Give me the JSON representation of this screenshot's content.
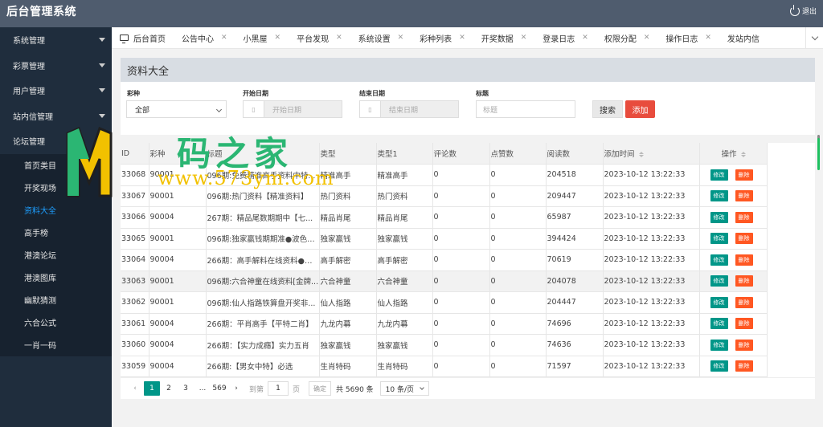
{
  "header": {
    "title": "后台管理系统",
    "logout_label": "退出"
  },
  "sidebar": {
    "groups": [
      {
        "label": "系统管理"
      },
      {
        "label": "彩票管理"
      },
      {
        "label": "用户管理"
      },
      {
        "label": "站内信管理"
      },
      {
        "label": "论坛管理"
      }
    ],
    "sub_items": [
      {
        "label": "首页类目"
      },
      {
        "label": "开奖现场"
      },
      {
        "label": "资料大全",
        "active": true
      },
      {
        "label": "高手榜"
      },
      {
        "label": "港澳论坛"
      },
      {
        "label": "港澳图库"
      },
      {
        "label": "幽默猜测"
      },
      {
        "label": "六合公式"
      },
      {
        "label": "一肖一码"
      }
    ]
  },
  "tabs": [
    {
      "label": "后台首页"
    },
    {
      "label": "公告中心"
    },
    {
      "label": "小黑屋"
    },
    {
      "label": "平台发现"
    },
    {
      "label": "系统设置"
    },
    {
      "label": "彩种列表"
    },
    {
      "label": "开奖数据"
    },
    {
      "label": "登录日志"
    },
    {
      "label": "权限分配"
    },
    {
      "label": "操作日志"
    },
    {
      "label": "发站内信"
    }
  ],
  "tab_close_glyph": "✕",
  "panel": {
    "title": "资料大全",
    "filters": {
      "lottery_label": "彩种",
      "lottery_value": "全部",
      "start_label": "开始日期",
      "start_placeholder": "开始日期",
      "end_label": "结束日期",
      "end_placeholder": "结束日期",
      "title_label": "标题",
      "title_placeholder": "标题"
    },
    "search_label": "搜索",
    "add_label": "添加"
  },
  "table": {
    "columns": [
      "ID",
      "彩种",
      "标题",
      "类型",
      "类型1",
      "评论数",
      "点赞数",
      "阅读数",
      "添加时间",
      "操作"
    ],
    "edit_label": "修改",
    "delete_label": "删除",
    "rows": [
      [
        "33068",
        "90001",
        "096期:免费精准高手资料中特...",
        "精准高手",
        "精准高手",
        "0",
        "0",
        "204518",
        "2023-10-12 13:22:33"
      ],
      [
        "33067",
        "90001",
        "096期:热门资料【精准资料】",
        "热门资料",
        "热门资料",
        "0",
        "0",
        "209447",
        "2023-10-12 13:22:33"
      ],
      [
        "33066",
        "90004",
        "267期：精品尾数期期中【七...",
        "精品肖尾",
        "精品肖尾",
        "0",
        "0",
        "65987",
        "2023-10-12 13:22:33"
      ],
      [
        "33065",
        "90001",
        "096期:独家赢钱期期准●波色+...",
        "独家赢钱",
        "独家赢钱",
        "0",
        "0",
        "394424",
        "2023-10-12 13:22:33"
      ],
      [
        "33064",
        "90004",
        "266期：高手解料在线资料●绝...",
        "高手解密",
        "高手解密",
        "0",
        "0",
        "70619",
        "2023-10-12 13:22:33"
      ],
      [
        "33063",
        "90001",
        "096期:六合神童在线资料[金牌...",
        "六合神童",
        "六合神童",
        "0",
        "0",
        "204078",
        "2023-10-12 13:22:33"
      ],
      [
        "33062",
        "90001",
        "096期:仙人指路铁算盘开奖非...",
        "仙人指路",
        "仙人指路",
        "0",
        "0",
        "204447",
        "2023-10-12 13:22:33"
      ],
      [
        "33061",
        "90004",
        "266期：平肖高手【平特二肖】",
        "九龙内幕",
        "九龙内幕",
        "0",
        "0",
        "74696",
        "2023-10-12 13:22:33"
      ],
      [
        "33060",
        "90004",
        "266期：【实力成癮】实力五肖",
        "独家赢钱",
        "独家赢钱",
        "0",
        "0",
        "74636",
        "2023-10-12 13:22:33"
      ],
      [
        "33059",
        "90004",
        "266期:【男女中特】必选",
        "生肖特码",
        "生肖特码",
        "0",
        "0",
        "71597",
        "2023-10-12 13:22:33"
      ]
    ],
    "highlight_row_index": 5
  },
  "pager": {
    "pages": [
      "1",
      "2",
      "3"
    ],
    "ellipsis": "...",
    "last_page": "569",
    "current": "1",
    "goto_label": "到第",
    "goto_value": "1",
    "page_suffix": "页",
    "confirm_label": "确定",
    "total_label": "共 5690 条",
    "page_size_label": "10 条/页",
    "prev_glyph": "‹",
    "next_glyph": "›"
  },
  "watermark": {
    "brand_cn": "码之家",
    "brand_url": "www.573ym.com",
    "colors": {
      "green": "#2bb673",
      "yellow": "#f2c100"
    }
  },
  "colors": {
    "header_bg": "#4f5c6e",
    "sidebar_bg": "#1f2d3d",
    "accent_teal": "#009688",
    "accent_red": "#ff5722",
    "active_link": "#1e9fff"
  }
}
